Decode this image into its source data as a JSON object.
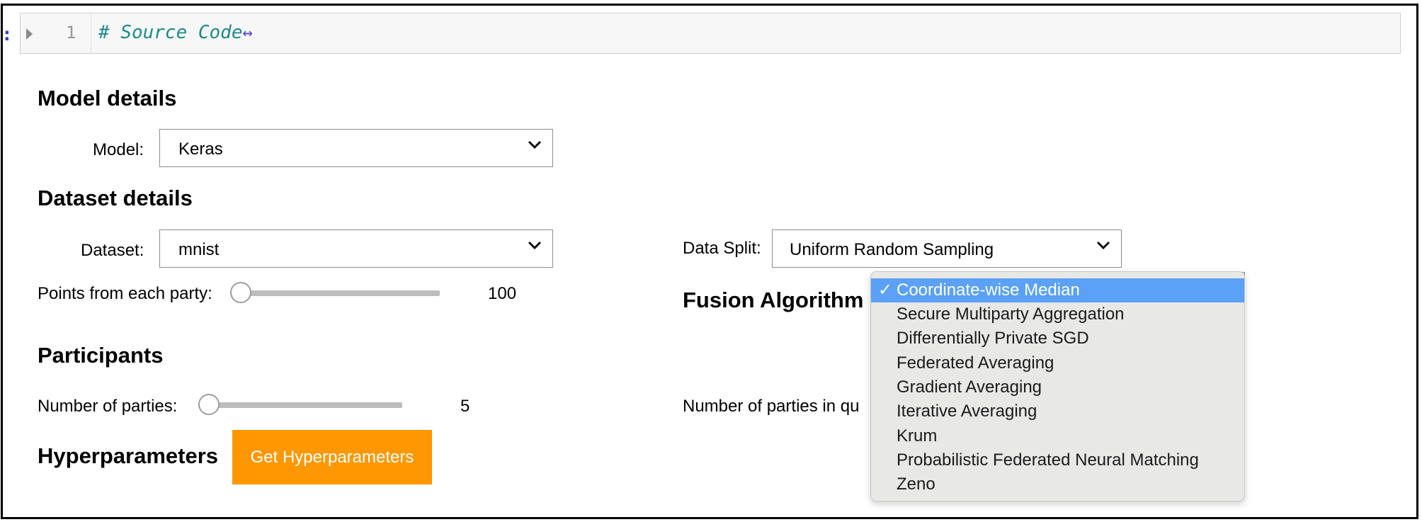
{
  "notebook": {
    "prompt": ":",
    "line_number": "1",
    "code": "# Source Code",
    "expand_glyph": "↔"
  },
  "model_section": {
    "heading": "Model details",
    "label": "Model:",
    "value": "Keras"
  },
  "dataset_section": {
    "heading": "Dataset details",
    "dataset_label": "Dataset:",
    "dataset_value": "mnist",
    "split_label": "Data Split:",
    "split_value": "Uniform Random Sampling",
    "points_label": "Points from each party:",
    "points_value": "100"
  },
  "fusion_section": {
    "heading": "Fusion Algorithm",
    "options": [
      "Coordinate-wise Median",
      "Secure Multiparty Aggregation",
      "Differentially Private SGD",
      "Federated Averaging",
      "Gradient Averaging",
      "Iterative Averaging",
      "Krum",
      "Probabilistic Federated Neural Matching",
      "Zeno"
    ],
    "selected_index": 0,
    "check_glyph": "✓"
  },
  "participants_section": {
    "heading": "Participants",
    "parties_label": "Number of parties:",
    "parties_value": "5",
    "quorum_label": "Number of parties in qu"
  },
  "hyperparameters_section": {
    "heading": "Hyperparameters",
    "button_label": "Get Hyperparameters"
  },
  "colors": {
    "button_bg": "#ff9800",
    "selected_option_bg": "#5aa1f7",
    "code_comment": "#1d8a8a"
  }
}
